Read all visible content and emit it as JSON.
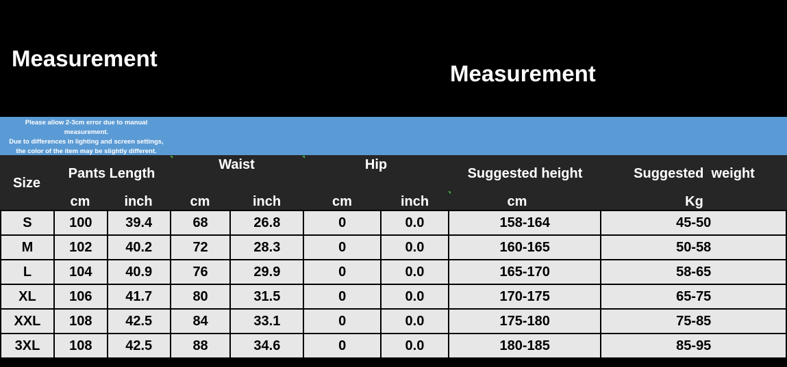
{
  "titles": {
    "left": "Measurement",
    "right": "Measurement"
  },
  "notice": {
    "lines": [
      "Please allow 2-3cm error due to manual",
      "measurement.",
      "Due to differences in lighting and screen settings,",
      "the color of the item may be slightly different."
    ]
  },
  "header": {
    "size": "Size",
    "groups": {
      "pants_length": "Pants Length",
      "waist": "Waist",
      "hip": "Hip",
      "suggested_height": "Suggested height",
      "suggested_weight": "Suggested  weight"
    },
    "units": [
      "cm",
      "inch",
      "cm",
      "inch",
      "cm",
      "inch",
      "cm",
      "Kg"
    ]
  },
  "rows": [
    [
      "S",
      "100",
      "39.4",
      "68",
      "26.8",
      "0",
      "0.0",
      "158-164",
      "45-50"
    ],
    [
      "M",
      "102",
      "40.2",
      "72",
      "28.3",
      "0",
      "0.0",
      "160-165",
      "50-58"
    ],
    [
      "L",
      "104",
      "40.9",
      "76",
      "29.9",
      "0",
      "0.0",
      "165-170",
      "58-65"
    ],
    [
      "XL",
      "106",
      "41.7",
      "80",
      "31.5",
      "0",
      "0.0",
      "170-175",
      "65-75"
    ],
    [
      "XXL",
      "108",
      "42.5",
      "84",
      "33.1",
      "0",
      "0.0",
      "175-180",
      "75-85"
    ],
    [
      "3XL",
      "108",
      "42.5",
      "88",
      "34.6",
      "0",
      "0.0",
      "180-185",
      "85-95"
    ]
  ],
  "colors": {
    "background": "#000000",
    "notice_bar": "#5b9bd5",
    "header_bar": "#262626",
    "cell_bg": "#e7e7e7"
  }
}
